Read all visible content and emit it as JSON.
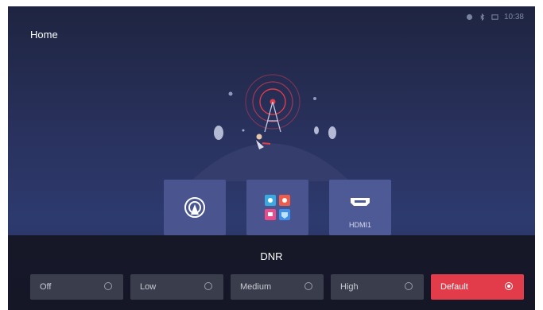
{
  "header": {
    "title": "Home"
  },
  "status": {
    "time": "10:38",
    "icons": [
      "network-icon",
      "bluetooth-icon",
      "source-icon"
    ]
  },
  "tiles": [
    {
      "icon": "antenna-icon",
      "label": ""
    },
    {
      "icon": "apps-icon",
      "label": ""
    },
    {
      "icon": "hdmi-icon",
      "label": "HDMI1"
    }
  ],
  "dnr": {
    "title": "DNR",
    "selected": "Default",
    "options": [
      {
        "label": "Off"
      },
      {
        "label": "Low"
      },
      {
        "label": "Medium"
      },
      {
        "label": "High"
      },
      {
        "label": "Default"
      }
    ]
  },
  "colors": {
    "accent": "#e23b4a",
    "tile": "#4a5590",
    "panel": "#16182a"
  }
}
